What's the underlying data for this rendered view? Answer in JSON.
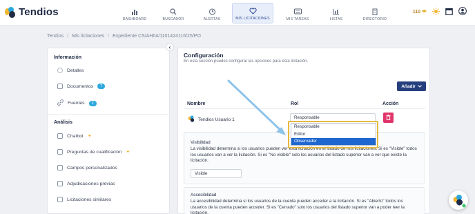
{
  "brand": {
    "name": "Tendios"
  },
  "nav": {
    "items": [
      {
        "label": "DASHBOARD",
        "icon": "bar-chart-icon"
      },
      {
        "label": "BUSCADOR",
        "icon": "search-icon"
      },
      {
        "label": "ALERTAS",
        "icon": "alarm-clock-icon"
      },
      {
        "label": "MIS LICITACIONES",
        "icon": "heart-icon",
        "active": true
      },
      {
        "label": "MIS TAREAS",
        "icon": "keyboard-icon"
      },
      {
        "label": "LISTAS",
        "icon": "list-chart-icon"
      },
      {
        "label": "DIRECTORIO",
        "icon": "building-icon"
      }
    ],
    "credits": "110",
    "tools": [
      "sun-icon",
      "calendar-icon",
      "user-icon"
    ]
  },
  "breadcrumb": {
    "items": [
      "Tendios",
      "Mis licitaciones",
      "Expediente CS/AH04/1101424116/25/PO"
    ]
  },
  "sidebar": {
    "section_info": "Información",
    "info_items": [
      {
        "label": "Detalles"
      },
      {
        "label": "Documentos",
        "badge": "7"
      },
      {
        "label": "Fuentes",
        "badge": "2"
      }
    ],
    "section_analysis": "Análisis",
    "analysis_items": [
      {
        "label": "Chatbot"
      },
      {
        "label": "Preguntas de cualificación"
      },
      {
        "label": "Campos personalizados"
      },
      {
        "label": "Adjudicaciones previas"
      },
      {
        "label": "Licitaciones similares"
      }
    ]
  },
  "main": {
    "title": "Configuración",
    "subtitle": "En esta sección puedes configurar las opciones para esta licitación.",
    "add_label": "Añadir",
    "columns": {
      "name": "Nombre",
      "role": "Rol",
      "action": "Acción"
    },
    "user": {
      "name": "Tendios Usuario 1",
      "role": "Responsable"
    },
    "role_options": [
      "Responsable",
      "Editor",
      "Observador"
    ],
    "role_option_selected": "Observador",
    "visibility": {
      "title": "Visibilidad",
      "description": "La visibilidad determina si los usuarios pueden ver esta licitación en el listado de mis licitaciones. Si es \"Visible\" todos los usuarios van a ver la licitación. Si es \"No visible\" solo los usuarios del listado superior van a ver que existe la licitación.",
      "value": "Visible"
    },
    "access": {
      "title": "Accesibilidad",
      "description": "La accesibilidad determina si los usuarios de la cuenta pueden acceder a la licitación. Si es \"Abierto\" todos los usuarios de la cuenta pueden acceder. Si es \"Cerrado\" solo los usuarios del listado superior van a poder leer la licitación."
    }
  },
  "colors": {
    "brand_navy": "#1f2a44",
    "primary": "#26407e",
    "danger": "#e0356b",
    "badge": "#2ea8dc",
    "highlight": "#e6b83d",
    "arrow": "#8ec3ea"
  }
}
